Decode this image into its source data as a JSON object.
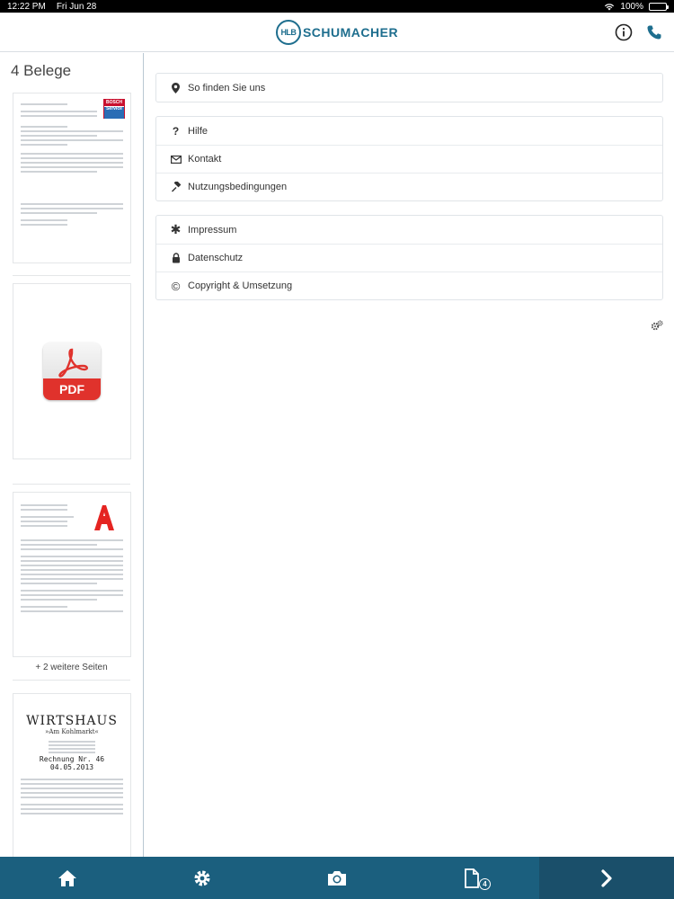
{
  "statusbar": {
    "time": "12:22 PM",
    "date": "Fri Jun 28",
    "battery": "100%"
  },
  "header": {
    "logo_badge": "HLB",
    "logo_text": "SCHUMACHER",
    "info_icon": "info-icon",
    "phone_icon": "phone-icon"
  },
  "sidebar": {
    "title": "4 Belege",
    "documents": [
      {
        "type": "invoice",
        "brand": "BOSCH Service"
      },
      {
        "type": "pdf",
        "label": "PDF"
      },
      {
        "type": "receipt",
        "more_pages": "+ 2 weitere Seiten"
      },
      {
        "type": "receipt",
        "title": "WIRTSHAUS",
        "subtitle": "»Am Kohlmarkt«",
        "invoice_no": "Rechnung Nr. 46",
        "date": "04.05.2013"
      }
    ]
  },
  "menu": {
    "groups": [
      {
        "items": [
          {
            "label": "So finden Sie uns",
            "icon": "map-marker-icon"
          }
        ]
      },
      {
        "items": [
          {
            "label": "Hilfe",
            "icon": "question-icon"
          },
          {
            "label": "Kontakt",
            "icon": "envelope-icon"
          },
          {
            "label": "Nutzungsbedingungen",
            "icon": "gavel-icon"
          }
        ]
      },
      {
        "items": [
          {
            "label": "Impressum",
            "icon": "asterisk-icon"
          },
          {
            "label": "Datenschutz",
            "icon": "lock-icon"
          },
          {
            "label": "Copyright & Umsetzung",
            "icon": "copyright-icon"
          }
        ]
      }
    ]
  },
  "tabbar": {
    "items": [
      {
        "icon": "home-icon"
      },
      {
        "icon": "gear-icon"
      },
      {
        "icon": "camera-icon"
      },
      {
        "icon": "documents-icon",
        "badge": "4"
      },
      {
        "icon": "chevron-right-icon"
      }
    ]
  },
  "colors": {
    "brand": "#1e6e8e",
    "tabbar": "#1b5f7e",
    "pdf_red": "#e0322c",
    "pharmacy_red": "#e52421"
  }
}
